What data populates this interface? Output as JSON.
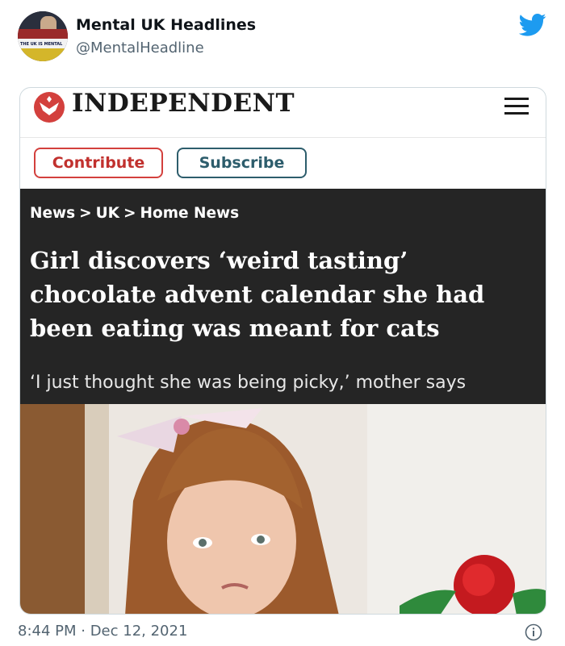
{
  "tweet": {
    "author": {
      "display_name": "Mental UK Headlines",
      "handle": "@MentalHeadline",
      "avatar_text": "THE UK IS MENTAL"
    },
    "timestamp": "8:44 PM · Dec 12, 2021",
    "icons": {
      "brand": "twitter-bird-icon",
      "info": "info-icon"
    },
    "colors": {
      "twitter_blue": "#1d9bf0",
      "secondary_text": "#536471"
    }
  },
  "article": {
    "masthead": "INDEPENDENT",
    "buttons": {
      "contribute": "Contribute",
      "subscribe": "Subscribe"
    },
    "breadcrumbs": [
      "News",
      "UK",
      "Home News"
    ],
    "breadcrumb_separator": ">",
    "headline": "Girl discovers ‘weird tasting’ chocolate advent calendar she had been eating was meant for cats",
    "standfirst": "‘I just thought she was being picky,’ mother says",
    "colors": {
      "brand_red": "#d3403d",
      "subscribe_teal": "#2d5d6c",
      "panel_dark": "#252525"
    }
  }
}
